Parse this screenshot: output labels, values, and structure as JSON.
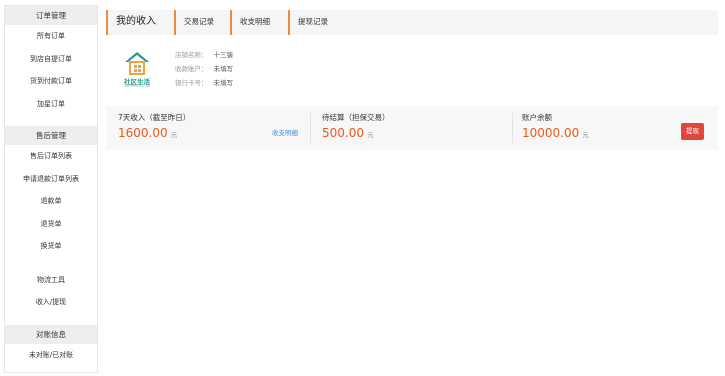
{
  "sidebar": {
    "groups": [
      {
        "title": "订单管理",
        "items": [
          "所有订单",
          "到店自提订单",
          "货到付款订单",
          "加星订单"
        ]
      },
      {
        "title": "售后管理",
        "items": [
          "售后订单列表",
          "申请退款订单列表",
          "退款单",
          "退货单",
          "换货单"
        ]
      },
      {
        "extra_items": [
          "物流工具",
          "收入/提现"
        ]
      },
      {
        "title": "对账信息",
        "items": [
          "未对账/已对账"
        ]
      }
    ]
  },
  "tabs": [
    "我的收入",
    "交易记录",
    "收支明细",
    "提现记录"
  ],
  "shop": {
    "logo_text": "社区生活",
    "logo_sub": "Community life",
    "rows": [
      {
        "label": "店铺名称：",
        "value": "十三猿"
      },
      {
        "label": "收款账户：",
        "value": "未填写"
      },
      {
        "label": "银行卡号：",
        "value": "未填写"
      }
    ]
  },
  "stats": {
    "income": {
      "label": "7天收入（截至昨日）",
      "value": "1600.00",
      "unit": "元",
      "link": "收支明细"
    },
    "pending": {
      "label": "待结算（担保交易）",
      "value": "500.00",
      "unit": "元"
    },
    "balance": {
      "label": "账户余额",
      "value": "10000.00",
      "unit": "元",
      "button": "提现"
    }
  },
  "colors": {
    "accent": "#f08a3c",
    "amount": "#e65a1e",
    "link": "#4a8ed8",
    "button": "#e0463e",
    "logo": "#1f9b8e"
  }
}
